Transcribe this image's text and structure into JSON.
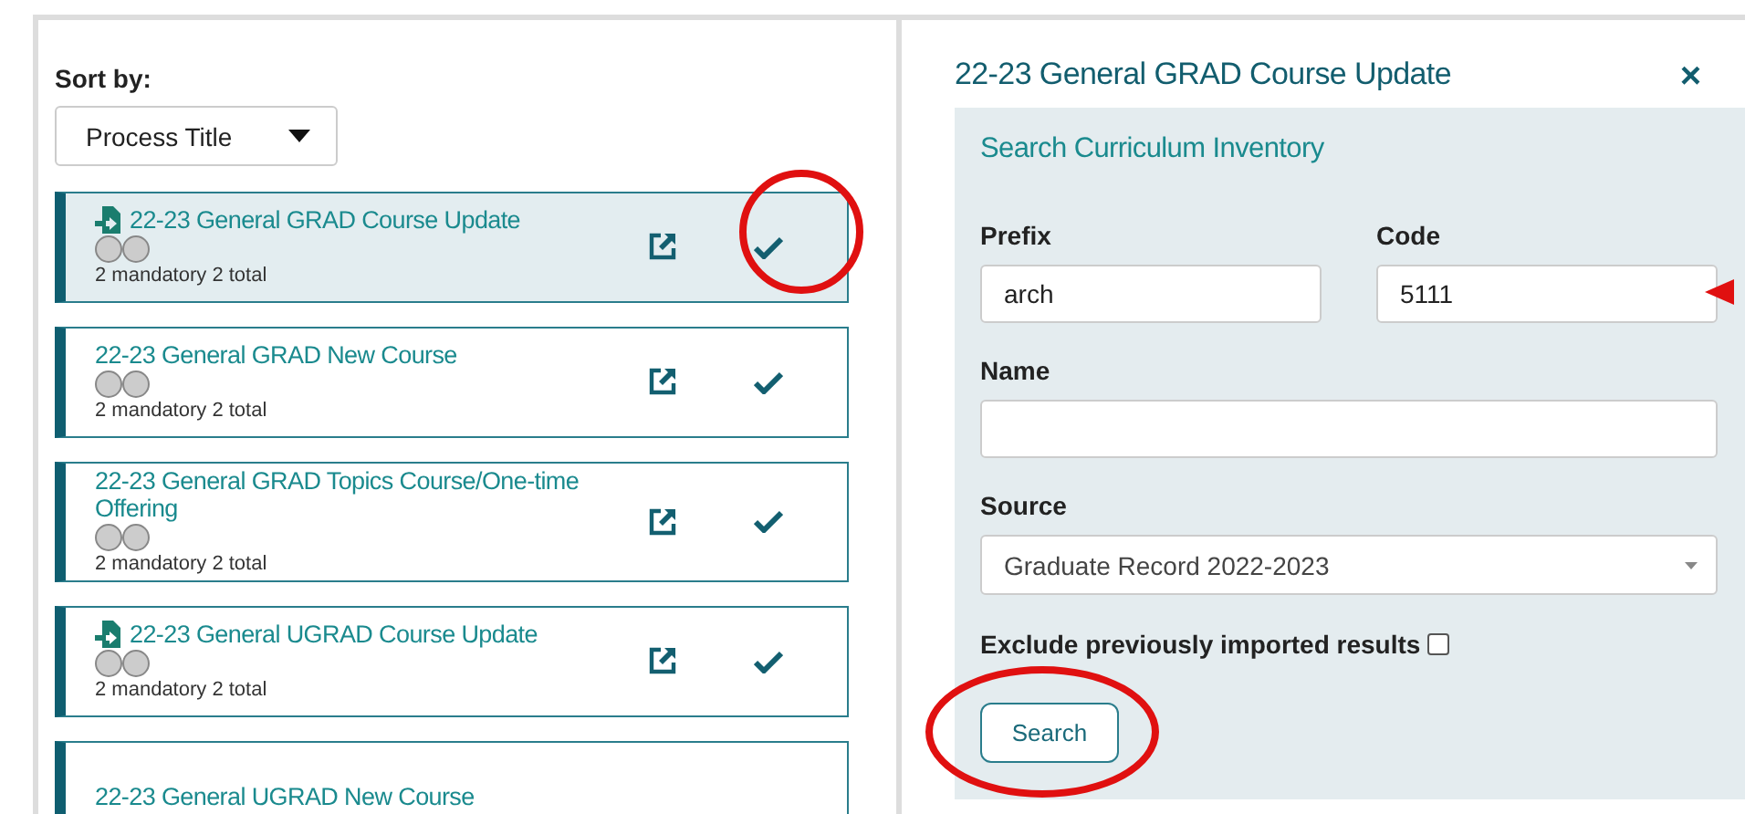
{
  "sort": {
    "label": "Sort by:",
    "value": "Process Title"
  },
  "processes": [
    {
      "title": "22-23 General GRAD Course Update",
      "import_icon": true,
      "summary": "2 mandatory 2 total",
      "selected": true,
      "circled": true
    },
    {
      "title": "22-23 General GRAD New Course",
      "import_icon": false,
      "summary": "2 mandatory 2 total",
      "selected": false,
      "circled": false
    },
    {
      "title": "22-23 General GRAD Topics Course/One-time Offering",
      "import_icon": false,
      "summary": "2 mandatory 2 total",
      "selected": false,
      "circled": false
    },
    {
      "title": "22-23 General UGRAD Course Update",
      "import_icon": true,
      "summary": "2 mandatory 2 total",
      "selected": false,
      "circled": false
    },
    {
      "title": "22-23 General UGRAD New Course",
      "import_icon": false,
      "selected": false,
      "circled": false
    }
  ],
  "detail": {
    "title": "22-23 General GRAD Course Update",
    "close": "×",
    "search_panel": {
      "heading": "Search Curriculum Inventory",
      "prefix": {
        "label": "Prefix",
        "value": "arch"
      },
      "code": {
        "label": "Code",
        "value": "5111",
        "pointed": true
      },
      "name": {
        "label": "Name"
      },
      "source": {
        "label": "Source",
        "value": "Graduate Record 2022-2023"
      },
      "exclude": {
        "label": "Exclude previously imported results",
        "checked": false
      },
      "search_button": {
        "label": "Search",
        "circled": true
      }
    }
  }
}
